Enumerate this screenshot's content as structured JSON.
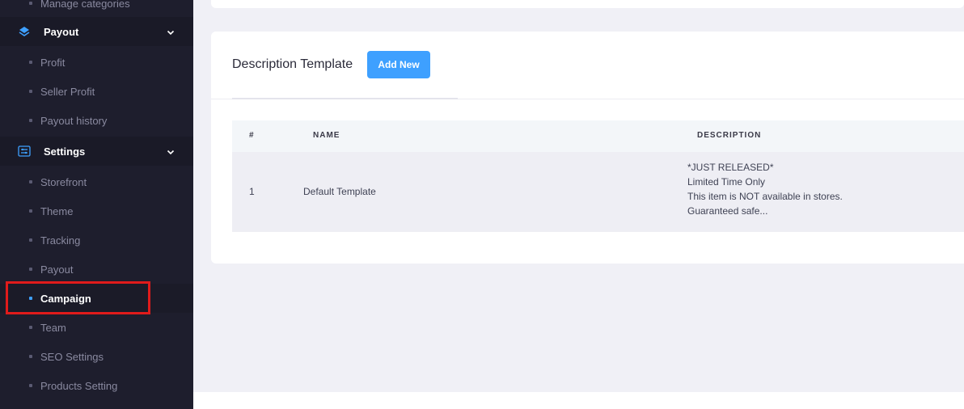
{
  "sidebar": {
    "top_partial": "Manage categories",
    "payout_section": {
      "label": "Payout",
      "items": [
        "Profit",
        "Seller Profit",
        "Payout history"
      ]
    },
    "settings_section": {
      "label": "Settings",
      "items": [
        "Storefront",
        "Theme",
        "Tracking",
        "Payout",
        "Campaign",
        "Team",
        "SEO Settings",
        "Products Setting"
      ]
    },
    "active_item": "Campaign"
  },
  "card": {
    "title": "Description Template",
    "add_button": "Add New"
  },
  "table": {
    "columns": [
      "#",
      "NAME",
      "DESCRIPTION"
    ],
    "rows": [
      {
        "num": "1",
        "name": "Default Template",
        "description_lines": [
          "*JUST RELEASED*",
          "Limited Time Only",
          "This item is NOT available in stores.",
          "Guaranteed safe..."
        ]
      }
    ]
  },
  "colors": {
    "sidebar_bg": "#1e1e2d",
    "accent": "#3ea0ff",
    "highlight": "#e01b1b",
    "page_bg": "#f0f0f6"
  }
}
